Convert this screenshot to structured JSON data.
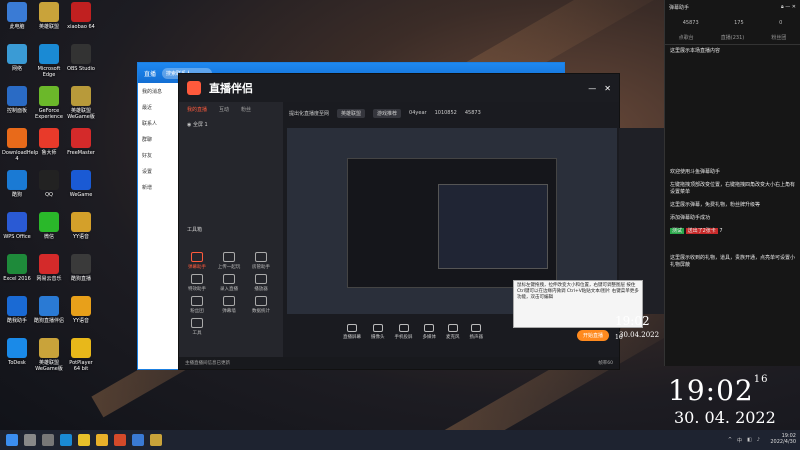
{
  "desktop": {
    "icons": [
      {
        "label": "此电脑",
        "color": "#3a7bd5"
      },
      {
        "label": "英雄联盟",
        "color": "#c9a33a"
      },
      {
        "label": "xiaobao 64",
        "color": "#c02020"
      },
      {
        "label": "网络",
        "color": "#3a9bd5"
      },
      {
        "label": "Microsoft Edge",
        "color": "#1a8ad4"
      },
      {
        "label": "OBS Studio",
        "color": "#333333"
      },
      {
        "label": "控制面板",
        "color": "#2a6bc5"
      },
      {
        "label": "GeForce Experience",
        "color": "#6bb82a"
      },
      {
        "label": "英雄联盟 WeGame版",
        "color": "#b89a3a"
      },
      {
        "label": "DownloadHelp 4",
        "color": "#e86a1a"
      },
      {
        "label": "鲁大师",
        "color": "#e83a2a"
      },
      {
        "label": "FreeMaster",
        "color": "#d42a2a"
      },
      {
        "label": "酷狗",
        "color": "#1a7ad4"
      },
      {
        "label": "QQ",
        "color": "#222222"
      },
      {
        "label": "WeGame",
        "color": "#1a5ad4"
      },
      {
        "label": "WPS Office",
        "color": "#2a5ad4"
      },
      {
        "label": "微信",
        "color": "#2ab82a"
      },
      {
        "label": "YY语音",
        "color": "#d4a02a"
      },
      {
        "label": "Excel 2016",
        "color": "#1e8a3a"
      },
      {
        "label": "网易云音乐",
        "color": "#d42a2a"
      },
      {
        "label": "酷狗直播",
        "color": "#3a3a3a"
      },
      {
        "label": "酷我助手",
        "color": "#1a6ad4"
      },
      {
        "label": "酷狗直播伴侣",
        "color": "#2a7ad4"
      },
      {
        "label": "YY语音",
        "color": "#e8a01a"
      },
      {
        "label": "ToDesk",
        "color": "#1a8ae8"
      },
      {
        "label": "英雄联盟 WeGame版",
        "color": "#c9a33a"
      },
      {
        "label": "PotPlayer 64 bit",
        "color": "#e8b81a"
      }
    ]
  },
  "chat_window": {
    "title": "直播",
    "search_placeholder": "搜索联系人",
    "sidebar": [
      "我的消息",
      "最近",
      "联系人",
      "群聊",
      "好友",
      "设置",
      "新增"
    ]
  },
  "live_app": {
    "title": "直播伴侣",
    "tabs": [
      "我的直播",
      "互动",
      "粉丝"
    ],
    "scene": "全屏 1",
    "meta": {
      "title": "提出化直播度至网",
      "category": "英雄联盟",
      "tag": "游戏推荐",
      "viewers": "04year",
      "views": "1010852",
      "likes": "45873"
    },
    "tools_title": "工具箱",
    "tools": [
      "弹幕助手",
      "上传一起玩",
      "房管助手",
      "特效助手",
      "录入直播",
      "播放器",
      "粉丝团",
      "弹幕墙",
      "数据统计",
      "工具"
    ],
    "controls": [
      "直播屏幕",
      "摄像头",
      "手机投屏",
      "多媒体",
      "麦克风",
      "扬声器"
    ],
    "start_button": "开始直播",
    "status": "主播直播间信息已更新",
    "fps": "帧率60",
    "preview_tip": "鼠标左键拖拽，拉伸改变大小和位置，右键可调整图层 按住Ctrl键可以在边缘内微调 Ctrl+V粘贴文本/图片 右键菜单更多功能，双击可编辑",
    "preview_clock": "19:02",
    "preview_clock_sec": "16",
    "preview_date": "30.04.2022"
  },
  "right_panel": {
    "title": "弹幕助手",
    "stat1": "45873",
    "stat2": "175",
    "stat3": "0",
    "tabs": [
      "点歌台",
      "直播(231)",
      "粉丝团"
    ],
    "messages": [
      "这里展示本场直播内容",
      "欢迎使用斗鱼弹幕助手",
      "左键拖拽顶部改变位置，右键拖拽四角改变大小右上角有设置菜单",
      "这里展示弹幕，免费礼物，粉丝牌升级等",
      "添加弹幕助手成功",
      "这里展示收到的礼物，道具，贵族开通，点亮单可设置小礼物屏蔽"
    ],
    "gift_user": "测试",
    "gift_text": "送出了2张卡",
    "gift_count": "7"
  },
  "clock": {
    "time": "19:02",
    "seconds": "16",
    "date": "30. 04. 2022"
  },
  "taskbar": {
    "ime": "中",
    "time": "19:02",
    "date": "2022/4/30",
    "icons": [
      {
        "name": "start-icon",
        "color": "#3b8ef0"
      },
      {
        "name": "search-icon",
        "color": "#888888"
      },
      {
        "name": "taskview-icon",
        "color": "#777777"
      },
      {
        "name": "edge-icon",
        "color": "#1a8ad4"
      },
      {
        "name": "chrome-icon",
        "color": "#e8c02a"
      },
      {
        "name": "explorer-icon",
        "color": "#e8b02a"
      },
      {
        "name": "app-icon",
        "color": "#d44a2a"
      },
      {
        "name": "kuaishou-icon",
        "color": "#3a7ad4"
      },
      {
        "name": "lol-icon",
        "color": "#c9a33a"
      }
    ]
  }
}
